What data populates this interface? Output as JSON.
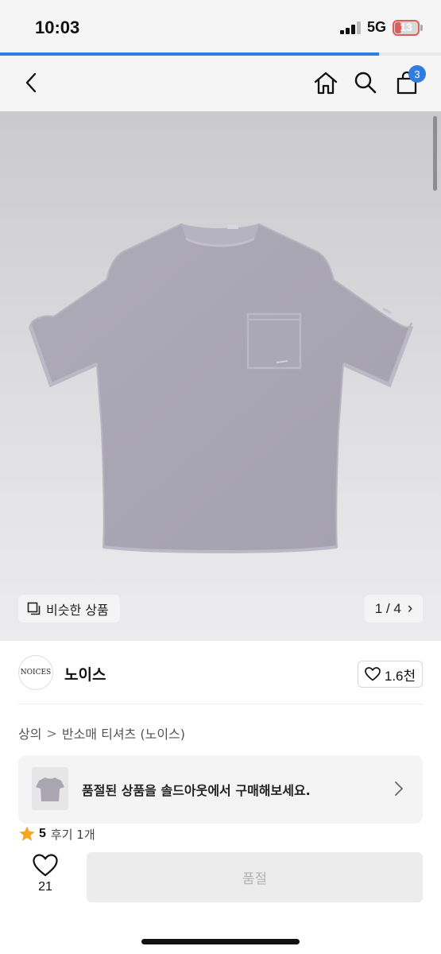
{
  "status_bar": {
    "time": "10:03",
    "network": "5G",
    "battery_level": "13"
  },
  "page_load_progress": 0.86,
  "nav": {
    "cart_count": "3"
  },
  "gallery": {
    "similar_label": "비슷한 상품",
    "counter": "1 / 4",
    "counter_arrow": "›",
    "image_count": 4,
    "current_image": 1
  },
  "brand": {
    "logo_text": "NOICES",
    "name": "노이스",
    "likes": "1.6천"
  },
  "breadcrumb": {
    "category": "상의",
    "separator": ">",
    "subcategory": "반소매 티셔츠 (노이스)"
  },
  "soldout_banner": {
    "text": "품절된 상품을 솔드아웃에서 구매해보세요."
  },
  "rating": {
    "score": "5",
    "reviews": "후기 1개"
  },
  "bottom": {
    "wish_count": "21",
    "soldout_label": "품절"
  },
  "colors": {
    "accent": "#2f7de1",
    "star": "#f5a623",
    "shirt": "#a9a6b2",
    "battery": "#e05b5b"
  }
}
